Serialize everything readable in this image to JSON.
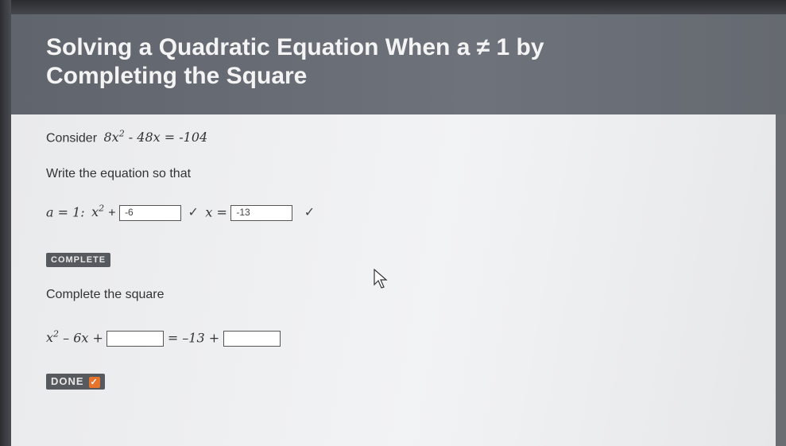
{
  "header": {
    "title": "Solving a Quadratic Equation When a ≠ 1 by Completing the Square"
  },
  "step1": {
    "prompt": "Consider",
    "equation_coef": "8x",
    "equation_exp": "2",
    "equation_rest": " - 48x = -104",
    "instruction": "Write the equation so that",
    "a_label": "a = 1:",
    "x2": "x",
    "x2_exp": "2",
    "plus": "+",
    "box1_value": "-6",
    "x_eq": "x =",
    "box2_value": "-13",
    "check": "✓"
  },
  "complete_button": {
    "label": "COMPLETE"
  },
  "step2": {
    "instruction": "Complete the square",
    "x2": "x",
    "x2_exp": "2",
    "middle": " – 6x +",
    "equals_part": "= –13 +",
    "box1_value": "",
    "box2_value": ""
  },
  "done_button": {
    "label": "DONE",
    "icon": "check-icon"
  }
}
